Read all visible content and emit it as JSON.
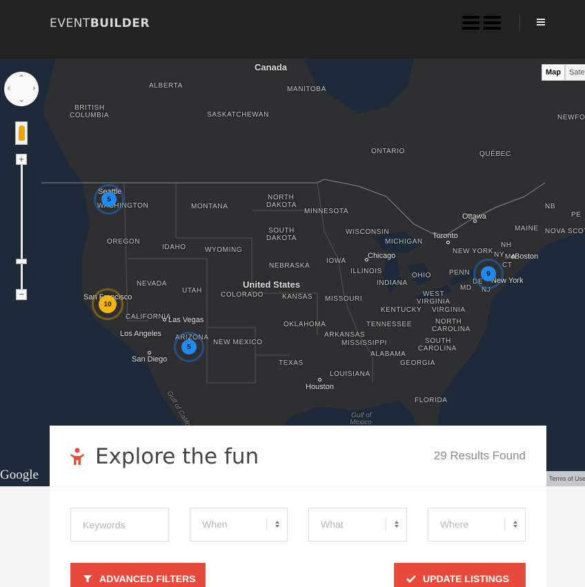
{
  "header": {
    "logo_light": "EVENT",
    "logo_bold": "BUILDER"
  },
  "map": {
    "country_labels": [
      "Canada",
      "United States"
    ],
    "region_labels": [
      "ALBERTA",
      "BRITISH",
      "COLUMBIA",
      "MANITOBA",
      "SASKATCHEWAN",
      "ONTARIO",
      "QUÉBEC",
      "NEWFOUNDLAND",
      "NB",
      "PE",
      "NOVA SCOT",
      "MAINE",
      "NORTH",
      "DAKOTA",
      "SOUTH",
      "DAKOTA",
      "MONTANA",
      "MINNESOTA",
      "WASHINGTON",
      "OREGON",
      "IDAHO",
      "WYOMING",
      "WISCONSIN",
      "MICHIGAN",
      "IOWA",
      "NEBRASKA",
      "ILLINOIS",
      "INDIANA",
      "OHIO",
      "PENN",
      "NY",
      "NEW YORK",
      "NH",
      "MA",
      "CT",
      "MD",
      "DE",
      "NJ",
      "NEVADA",
      "UTAH",
      "COLORADO",
      "KANSAS",
      "MISSOURI",
      "WEST",
      "VIRGINIA",
      "KENTUCKY",
      "VIRGINIA",
      "CALIFORNIA",
      "ARIZONA",
      "NEW MEXICO",
      "OKLAHOMA",
      "TENNESSEE",
      "NORTH",
      "CAROLINA",
      "ARKANSAS",
      "MISSISSIPPI",
      "ALABAMA",
      "SOUTH",
      "CAROLINA",
      "GEORGIA",
      "TEXAS",
      "LOUISIANA",
      "FLORIDA"
    ],
    "city_labels": [
      "Seattle",
      "San Francisco",
      "Las Vegas",
      "Los Angeles",
      "San Diego",
      "Chicago",
      "Toronto",
      "Ottawa",
      "Boston",
      "New York",
      "Houston"
    ],
    "water_labels": [
      "Gulf of California",
      "Gulf of",
      "Mexico"
    ],
    "clusters": [
      {
        "count": "5",
        "color": "#1f8af0"
      },
      {
        "count": "10",
        "color": "#f2b60f"
      },
      {
        "count": "5",
        "color": "#1f8af0"
      },
      {
        "count": "9",
        "color": "#1f8af0"
      }
    ],
    "map_type_active": "Map",
    "map_type_inactive": "Satellite",
    "attribution": "Google",
    "terms": "Terms of Use"
  },
  "panel": {
    "title": "Explore the fun",
    "results": "29 Results Found",
    "keywords_placeholder": "Keywords",
    "when_label": "When",
    "what_label": "What",
    "where_label": "Where",
    "advanced_filters": "ADVANCED FILTERS",
    "update_listings": "UPDATE LISTINGS",
    "accent": "#e84b3c"
  }
}
